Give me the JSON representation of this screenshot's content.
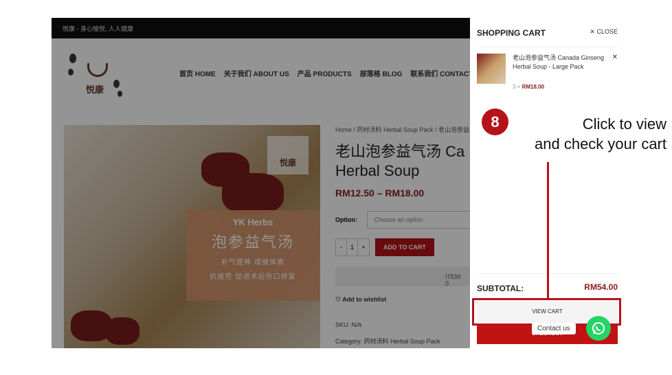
{
  "topbar": {
    "text": "悦康 - 身心愉悦, 人人健康"
  },
  "logo": {
    "text": "悦康"
  },
  "nav": [
    {
      "label": "首页 HOME"
    },
    {
      "label": "关于我们 ABOUT US"
    },
    {
      "label": "产品 PRODUCTS"
    },
    {
      "label": "部落格 BLOG"
    },
    {
      "label": "联系我们 CONTACT"
    }
  ],
  "product_image": {
    "brand": "YK Herbs",
    "title": "泡参益气汤",
    "line1": "补气提神  增强体质",
    "line2": "抗疲劳  促进术后伤口修复",
    "badge": "悦康"
  },
  "product": {
    "breadcrumb": "Home / 药材汤料 Herbal Soup Pack / 老山泡参益",
    "title_line1": "老山泡参益气汤 Ca",
    "title_line2": "Herbal Soup",
    "price": "RM12.50 – RM18.00",
    "option_label": "Option:",
    "option_placeholder": "Choose an option",
    "qty_minus": "-",
    "qty_value": "1",
    "qty_plus": "+",
    "add_to_cart": "ADD TO CART",
    "items_text": "ITEM: 0",
    "wishlist": "Add to wishlist",
    "sku": "SKU: N/A",
    "category": "Category: 药材汤料 Herbal Soup Pack"
  },
  "cart": {
    "title": "SHOPPING CART",
    "close": "CLOSE",
    "item_name": "老山泡参益气汤 Canada Ginseng Herbal Soup - Large Pack",
    "item_qty": "3 ×",
    "item_price": "RM18.00",
    "subtotal_label": "SUBTOTAL:",
    "subtotal_value": "RM54.00",
    "view_cart": "VIEW CART",
    "checkout": "CHECKOUT"
  },
  "annotation": {
    "step": "8",
    "line1": "Click to view",
    "line2": "and check your cart",
    "color": "#b5121b"
  },
  "whatsapp": {
    "tooltip": "Contact us",
    "icon": "whatsapp-icon",
    "color": "#25d366"
  }
}
